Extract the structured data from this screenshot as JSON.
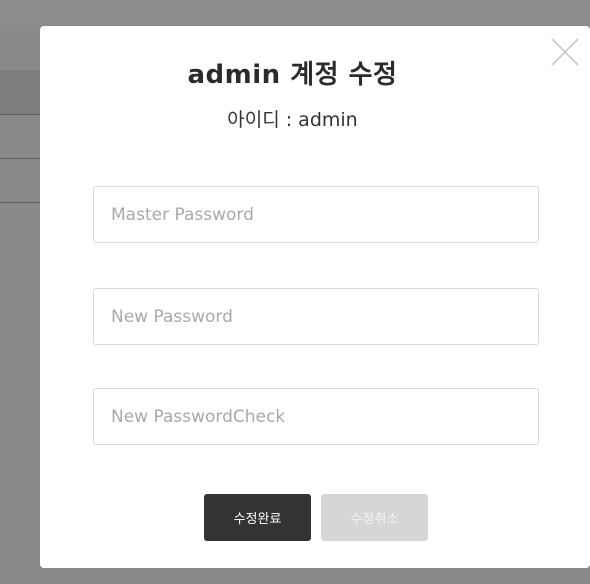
{
  "modal": {
    "title": "admin 계정 수정",
    "subtitle": "아이디 : admin"
  },
  "fields": {
    "master_password": {
      "placeholder": "Master Password",
      "value": ""
    },
    "new_password": {
      "placeholder": "New Password",
      "value": ""
    },
    "new_password_check": {
      "placeholder": "New PasswordCheck",
      "value": ""
    }
  },
  "buttons": {
    "save_label": "수정완료",
    "cancel_label": "수정취소"
  },
  "icons": {
    "close": "close-icon"
  },
  "colors": {
    "save_button": "#333333",
    "cancel_button": "#d6d6d6",
    "overlay": "#898989"
  }
}
